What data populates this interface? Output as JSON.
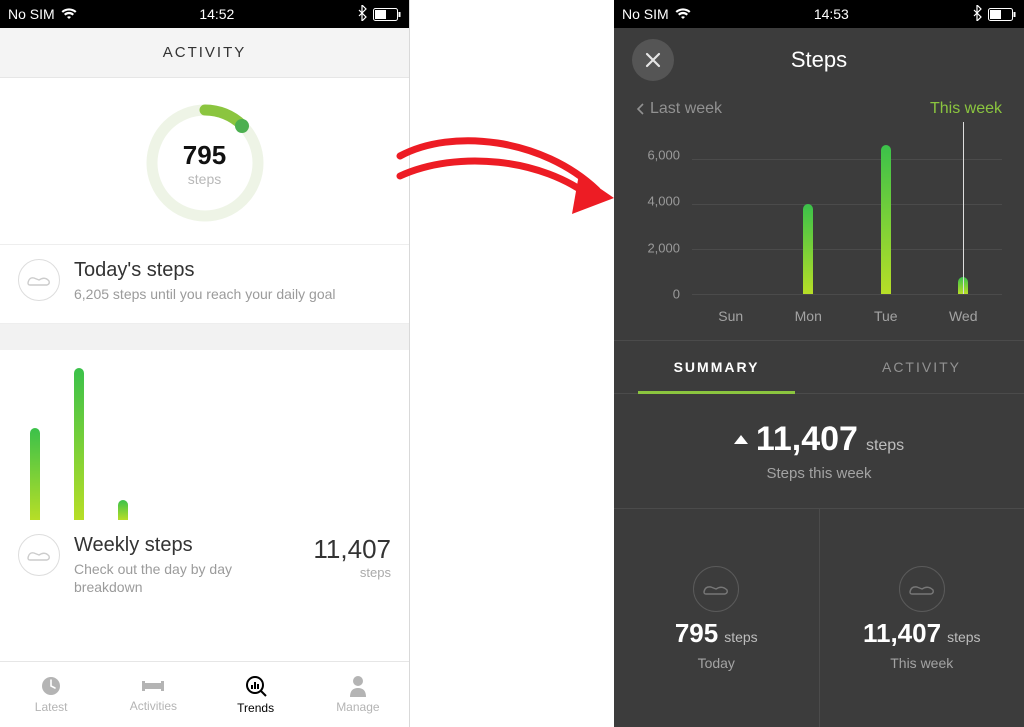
{
  "status_left": {
    "no_sim": "No SIM",
    "time": "14:52"
  },
  "status_right": {
    "no_sim": "No SIM",
    "time": "14:53"
  },
  "activity": {
    "header": "ACTIVITY",
    "ring_value": "795",
    "ring_unit": "steps",
    "today_title": "Today's steps",
    "today_sub": "6,205 steps until you reach your daily goal",
    "weekly_title": "Weekly steps",
    "weekly_sub": "Check out the day by day breakdown",
    "weekly_value": "11,407",
    "weekly_unit": "steps"
  },
  "tabs": {
    "latest": "Latest",
    "activities": "Activities",
    "trends": "Trends",
    "manage": "Manage"
  },
  "steps": {
    "title": "Steps",
    "last_week": "Last week",
    "this_week": "This week",
    "y_labels": [
      "6,000",
      "4,000",
      "2,000",
      "0"
    ],
    "x_labels": [
      "Sun",
      "Mon",
      "Tue",
      "Wed"
    ],
    "tab_summary": "SUMMARY",
    "tab_activity": "ACTIVITY",
    "summary_value": "11,407",
    "summary_unit": "steps",
    "summary_sub": "Steps this week",
    "foot_today_value": "795",
    "foot_today_unit": "steps",
    "foot_today_sub": "Today",
    "foot_week_value": "11,407",
    "foot_week_unit": "steps",
    "foot_week_sub": "This week"
  },
  "chart_data": [
    {
      "type": "bar",
      "title": "Weekly steps (left overview)",
      "categories": [
        "Mon",
        "Tue",
        "Wed"
      ],
      "values": [
        4000,
        6600,
        795
      ],
      "ylim": [
        0,
        7000
      ]
    },
    {
      "type": "bar",
      "title": "Steps this week",
      "categories": [
        "Sun",
        "Mon",
        "Tue",
        "Wed"
      ],
      "values": [
        0,
        4000,
        6600,
        795
      ],
      "xlabel": "",
      "ylabel": "",
      "ylim": [
        0,
        7000
      ],
      "y_ticks": [
        0,
        2000,
        4000,
        6000
      ]
    }
  ]
}
